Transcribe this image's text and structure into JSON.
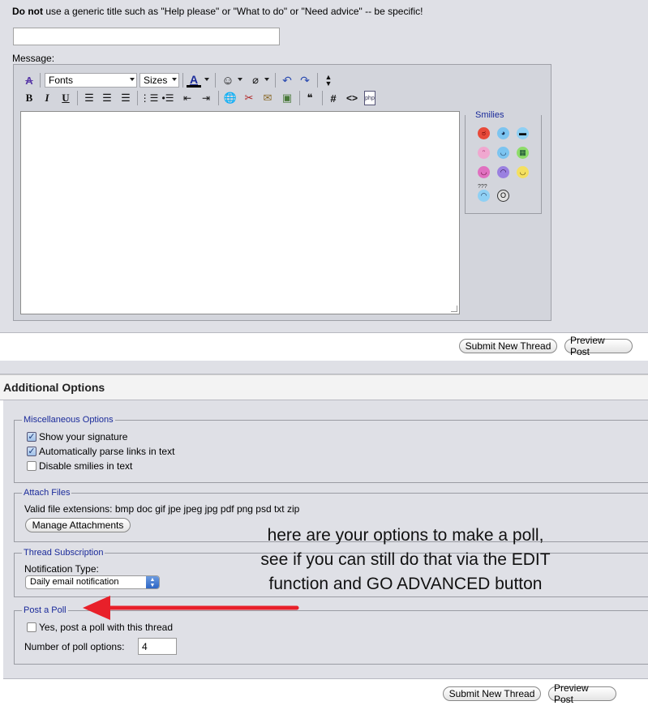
{
  "title_hint": {
    "bold": "Do not",
    "rest": " use a generic title such as \"Help please\" or \"What to do\" or \"Need advice\" -- be specific!"
  },
  "title_input": {
    "value": ""
  },
  "message_label": "Message:",
  "editor": {
    "font_dropdown": "Fonts",
    "size_dropdown": "Sizes",
    "bold": "B",
    "italic": "I",
    "underline": "U",
    "hash": "#",
    "code": "<>",
    "php": "php",
    "text_color_letter": "A"
  },
  "smilies": {
    "legend": "Smilies",
    "items": [
      "mad",
      "cool-blue",
      "sunglasses",
      "tongue",
      "smile-blue",
      "grin",
      "pink-happy",
      "frown",
      "smile",
      "confused",
      "eek",
      "apple"
    ]
  },
  "buttons": {
    "submit_new_thread": "Submit New Thread",
    "preview_post": "Preview Post"
  },
  "additional_options": {
    "title": "Additional Options",
    "misc": {
      "legend": "Miscellaneous Options",
      "show_signature": "Show your signature",
      "parse_links": "Automatically parse links in text",
      "disable_smilies": "Disable smilies in text"
    },
    "attach": {
      "legend": "Attach Files",
      "valid_ext": "Valid file extensions: bmp doc gif jpe jpeg jpg pdf png psd txt zip",
      "manage_button": "Manage Attachments"
    },
    "subscription": {
      "legend": "Thread Subscription",
      "notification_label": "Notification Type:",
      "notification_value": "Daily email notification"
    },
    "poll": {
      "legend": "Post a Poll",
      "yes_label": "Yes, post a poll with this thread",
      "count_label": "Number of poll options:",
      "count_value": "4"
    }
  },
  "annotation": {
    "line1": "here are your options to make a poll,",
    "line2": "see if you can still do that via the EDIT",
    "line3": "function and GO ADVANCED button"
  },
  "colors": {
    "panel": "#dfe0e6",
    "legend_text": "#1a2a9a",
    "arrow": "#e8202a"
  }
}
